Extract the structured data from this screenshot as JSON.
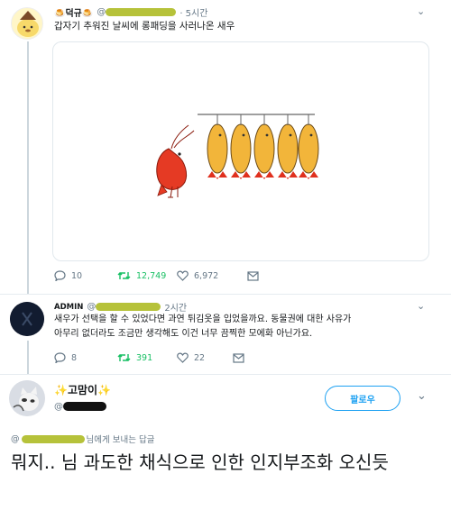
{
  "tweet1": {
    "name": "🍮덕규🍮",
    "handle_prefix": "@",
    "time": "· 5시간",
    "text": "갑자기 추워진 날씨에 롱패딩을 사러나온 새우",
    "replies": "10",
    "retweets": "12,749",
    "likes": "6,972"
  },
  "tweet2": {
    "name": "ADMIN",
    "handle_prefix": "@",
    "time": "2시간",
    "text_line1": "새우가 선택을 할 수 있었다면 과연 튀김옷을 입었을까요. 동물권에 대한 사유가",
    "text_line2": "아무리 없더라도 조금만 생각해도 이건 너무 끔찍한 모에화 아닌가요.",
    "replies": "8",
    "retweets": "391",
    "likes": "22"
  },
  "tweet3": {
    "name": "✨고맘이✨",
    "handle_prefix": "@",
    "follow_label": "팔로우",
    "reply_to_prefix": "@",
    "reply_to_suffix": "님에게 보내는 답글",
    "text": "뭐지.. 님 과도한 채식으로 인한 인지부조화 오신듯"
  },
  "icons": {
    "reply": "reply-icon",
    "retweet": "retweet-icon",
    "like": "heart-icon",
    "dm": "envelope-icon",
    "caret": "chevron-down-icon"
  },
  "colors": {
    "retweet": "#17bf63",
    "link": "#1da1f2",
    "muted": "#657786"
  }
}
